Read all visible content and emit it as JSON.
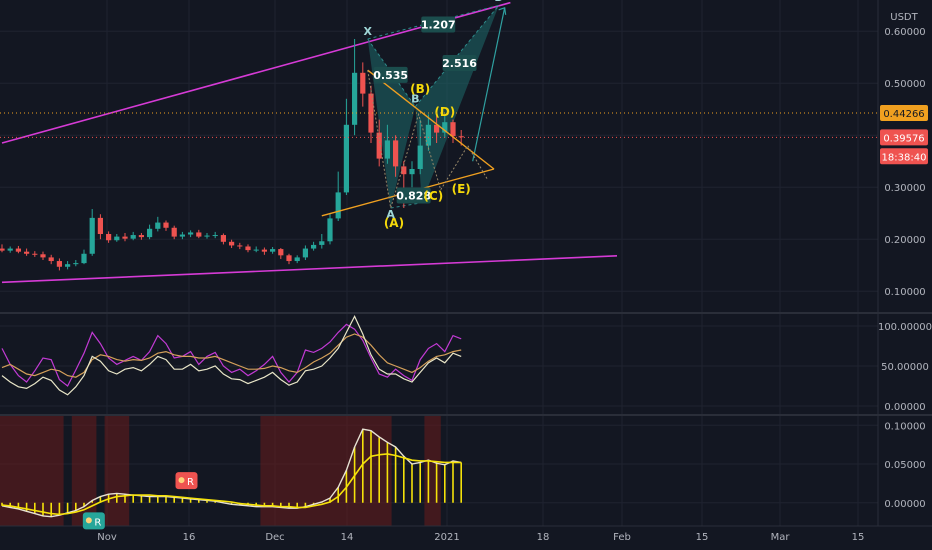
{
  "chart_data": {
    "type": "candlestick",
    "quote_currency": "USDT",
    "x_axis_labels": [
      "Nov",
      "16",
      "Dec",
      "14",
      "2021",
      "18",
      "Feb",
      "15",
      "Mar",
      "15"
    ],
    "price_axis": {
      "ticks": [
        0.1,
        0.2,
        0.3,
        0.4,
        0.5,
        0.6
      ],
      "tick_labels": [
        "0.10000",
        "0.20000",
        "0.30000",
        "0.40000",
        "0.50000",
        "0.60000"
      ],
      "range": [
        0.06,
        0.66
      ]
    },
    "price_tags": [
      {
        "label": "0.44266",
        "value": 0.44266,
        "color": "#f0a020",
        "text_color": "#131722"
      },
      {
        "label": "0.39576",
        "value": 0.39576,
        "color": "#ef5350",
        "text_color": "#ffffff"
      },
      {
        "label": "18:38:40",
        "value": 0.3595,
        "color": "#ef5350",
        "text_color": "#ffffff"
      }
    ],
    "series": [
      {
        "name": "candles",
        "open": [
          0.182,
          0.178,
          0.182,
          0.176,
          0.172,
          0.171,
          0.165,
          0.158,
          0.147,
          0.152,
          0.154,
          0.172,
          0.241,
          0.21,
          0.198,
          0.205,
          0.201,
          0.208,
          0.204,
          0.22,
          0.232,
          0.222,
          0.205,
          0.209,
          0.213,
          0.205,
          0.207,
          0.208,
          0.195,
          0.188,
          0.186,
          0.179,
          0.18,
          0.176,
          0.181,
          0.169,
          0.158,
          0.165,
          0.182,
          0.189,
          0.196,
          0.24,
          0.29,
          0.42,
          0.52,
          0.48,
          0.405,
          0.355,
          0.39,
          0.34,
          0.325,
          0.335,
          0.38,
          0.42,
          0.405,
          0.425,
          0.398
        ],
        "close": [
          0.178,
          0.182,
          0.176,
          0.172,
          0.171,
          0.165,
          0.158,
          0.147,
          0.152,
          0.154,
          0.172,
          0.241,
          0.21,
          0.198,
          0.205,
          0.201,
          0.208,
          0.204,
          0.22,
          0.232,
          0.222,
          0.205,
          0.209,
          0.213,
          0.205,
          0.207,
          0.208,
          0.195,
          0.188,
          0.186,
          0.179,
          0.18,
          0.176,
          0.181,
          0.169,
          0.158,
          0.165,
          0.182,
          0.189,
          0.196,
          0.24,
          0.29,
          0.42,
          0.52,
          0.48,
          0.405,
          0.355,
          0.39,
          0.34,
          0.325,
          0.335,
          0.38,
          0.42,
          0.405,
          0.425,
          0.398,
          0.396
        ],
        "high": [
          0.19,
          0.186,
          0.187,
          0.182,
          0.177,
          0.176,
          0.17,
          0.163,
          0.158,
          0.16,
          0.18,
          0.258,
          0.248,
          0.215,
          0.21,
          0.212,
          0.214,
          0.212,
          0.228,
          0.243,
          0.236,
          0.226,
          0.214,
          0.217,
          0.218,
          0.212,
          0.214,
          0.211,
          0.199,
          0.193,
          0.19,
          0.186,
          0.184,
          0.185,
          0.183,
          0.172,
          0.169,
          0.188,
          0.195,
          0.21,
          0.25,
          0.33,
          0.47,
          0.585,
          0.54,
          0.495,
          0.43,
          0.42,
          0.4,
          0.35,
          0.35,
          0.43,
          0.44,
          0.438,
          0.44,
          0.43,
          0.41
        ],
        "low": [
          0.175,
          0.174,
          0.173,
          0.168,
          0.166,
          0.16,
          0.152,
          0.14,
          0.142,
          0.148,
          0.152,
          0.168,
          0.2,
          0.193,
          0.195,
          0.196,
          0.198,
          0.199,
          0.2,
          0.215,
          0.216,
          0.2,
          0.2,
          0.204,
          0.202,
          0.201,
          0.202,
          0.19,
          0.183,
          0.181,
          0.175,
          0.175,
          0.17,
          0.172,
          0.162,
          0.152,
          0.154,
          0.16,
          0.178,
          0.182,
          0.19,
          0.235,
          0.285,
          0.4,
          0.455,
          0.385,
          0.34,
          0.345,
          0.32,
          0.26,
          0.3,
          0.325,
          0.37,
          0.385,
          0.395,
          0.385,
          0.38
        ]
      }
    ],
    "trendlines": [
      {
        "name": "upper channel",
        "color": "#d63bd6",
        "from": [
          0,
          0.385
        ],
        "to": [
          62,
          0.655
        ]
      },
      {
        "name": "lower channel",
        "color": "#d63bd6",
        "from": [
          0,
          0.117
        ],
        "to": [
          75,
          0.168
        ]
      }
    ],
    "triangle": {
      "color": "#f0a020",
      "upper": {
        "from": [
          44.6,
          0.525
        ],
        "to": [
          60,
          0.335
        ]
      },
      "lower": {
        "from": [
          39,
          0.245
        ],
        "to": [
          60,
          0.335
        ]
      },
      "wave_path": [
        [
          44.6,
          0.525
        ],
        [
          47.4,
          0.26
        ],
        [
          50.8,
          0.44
        ],
        [
          53.5,
          0.295
        ],
        [
          56.8,
          0.38
        ],
        [
          59.2,
          0.315
        ]
      ]
    },
    "harmonic": {
      "color": "#1e6a6a",
      "points": [
        {
          "label": "X",
          "x": 44.6,
          "y": 0.585
        },
        {
          "label": "A",
          "x": 47.4,
          "y": 0.26
        },
        {
          "label": "B",
          "x": 50.4,
          "y": 0.455
        },
        {
          "label": "C",
          "x": 51.2,
          "y": 0.27
        },
        {
          "label": "D",
          "x": 60.6,
          "y": 0.65
        }
      ],
      "ratios": [
        {
          "text": "1.207",
          "x": 53.2,
          "y": 0.611
        },
        {
          "text": "0.535",
          "x": 47.4,
          "y": 0.514
        },
        {
          "text": "2.516",
          "x": 55.8,
          "y": 0.537
        },
        {
          "text": "0.828",
          "x": 50.2,
          "y": 0.282
        }
      ]
    },
    "wave_labels": [
      {
        "text": "(A)",
        "x": 47.8,
        "y": 0.223
      },
      {
        "text": "(B)",
        "x": 51.0,
        "y": 0.481
      },
      {
        "text": "(C)",
        "x": 52.6,
        "y": 0.275
      },
      {
        "text": "(D)",
        "x": 54.0,
        "y": 0.437
      },
      {
        "text": "(E)",
        "x": 56.0,
        "y": 0.289
      }
    ],
    "oscillator": {
      "ticks": [
        0,
        50,
        100
      ],
      "tick_labels": [
        "0.00000",
        "50.00000",
        "100.00000"
      ],
      "range": [
        -10,
        115
      ],
      "series": [
        {
          "name": "magenta",
          "color": "#c23ad4",
          "values": [
            72,
            52,
            38,
            30,
            44,
            60,
            58,
            33,
            25,
            45,
            66,
            92,
            78,
            60,
            52,
            57,
            62,
            57,
            68,
            88,
            78,
            60,
            62,
            68,
            52,
            62,
            67,
            50,
            42,
            46,
            38,
            44,
            52,
            62,
            42,
            30,
            42,
            70,
            67,
            72,
            80,
            92,
            102,
            96,
            82,
            60,
            40,
            36,
            46,
            38,
            32,
            58,
            72,
            78,
            68,
            88,
            84
          ]
        },
        {
          "name": "tan",
          "color": "#d4a05a",
          "values": [
            48,
            52,
            46,
            40,
            38,
            42,
            46,
            44,
            38,
            36,
            42,
            58,
            64,
            62,
            58,
            56,
            58,
            57,
            60,
            66,
            68,
            64,
            62,
            62,
            60,
            60,
            62,
            58,
            54,
            50,
            46,
            46,
            47,
            50,
            48,
            44,
            42,
            48,
            55,
            60,
            66,
            76,
            86,
            90,
            86,
            76,
            64,
            54,
            50,
            46,
            42,
            48,
            56,
            62,
            64,
            68,
            70
          ]
        },
        {
          "name": "white",
          "color": "#e9e6c8",
          "values": [
            38,
            30,
            24,
            22,
            28,
            36,
            32,
            20,
            14,
            24,
            38,
            62,
            56,
            44,
            40,
            46,
            48,
            44,
            52,
            62,
            58,
            46,
            46,
            52,
            44,
            46,
            50,
            40,
            34,
            33,
            28,
            32,
            36,
            42,
            33,
            26,
            30,
            44,
            46,
            50,
            60,
            72,
            92,
            112,
            90,
            64,
            46,
            40,
            40,
            34,
            30,
            42,
            54,
            60,
            54,
            66,
            62
          ]
        }
      ]
    },
    "macd": {
      "ticks": [
        0,
        0.05,
        0.1
      ],
      "tick_labels": [
        "0.00000",
        "0.05000",
        "0.10000"
      ],
      "range": [
        -0.03,
        0.112
      ],
      "series": [
        {
          "name": "histogram",
          "color": "#e7e2d3",
          "values": [
            -0.004,
            -0.006,
            -0.008,
            -0.011,
            -0.014,
            -0.017,
            -0.018,
            -0.016,
            -0.013,
            -0.01,
            -0.005,
            0.003,
            0.008,
            0.011,
            0.012,
            0.011,
            0.01,
            0.009,
            0.008,
            0.008,
            0.008,
            0.007,
            0.006,
            0.005,
            0.004,
            0.003,
            0.002,
            0.0,
            -0.002,
            -0.003,
            -0.004,
            -0.005,
            -0.005,
            -0.005,
            -0.006,
            -0.007,
            -0.007,
            -0.005,
            -0.002,
            0.001,
            0.006,
            0.02,
            0.042,
            0.072,
            0.095,
            0.093,
            0.085,
            0.078,
            0.072,
            0.06,
            0.05,
            0.052,
            0.055,
            0.051,
            0.049,
            0.054,
            0.052
          ]
        },
        {
          "name": "signal",
          "color": "#f5e20a",
          "values": [
            -0.003,
            -0.004,
            -0.006,
            -0.008,
            -0.01,
            -0.012,
            -0.014,
            -0.015,
            -0.014,
            -0.012,
            -0.009,
            -0.004,
            0.001,
            0.005,
            0.008,
            0.009,
            0.01,
            0.01,
            0.01,
            0.009,
            0.009,
            0.008,
            0.007,
            0.006,
            0.005,
            0.004,
            0.003,
            0.002,
            0.001,
            -0.001,
            -0.002,
            -0.003,
            -0.004,
            -0.004,
            -0.005,
            -0.005,
            -0.006,
            -0.006,
            -0.004,
            -0.002,
            0.001,
            0.008,
            0.02,
            0.035,
            0.05,
            0.06,
            0.062,
            0.063,
            0.061,
            0.058,
            0.055,
            0.054,
            0.054,
            0.053,
            0.052,
            0.052,
            0.052
          ]
        }
      ],
      "badges": [
        {
          "text": "R",
          "x": 22.5,
          "y": 0.028,
          "color": "#ef5350"
        },
        {
          "text": "R",
          "x": 11.2,
          "y": -0.024,
          "color": "#26a69a"
        }
      ]
    }
  }
}
